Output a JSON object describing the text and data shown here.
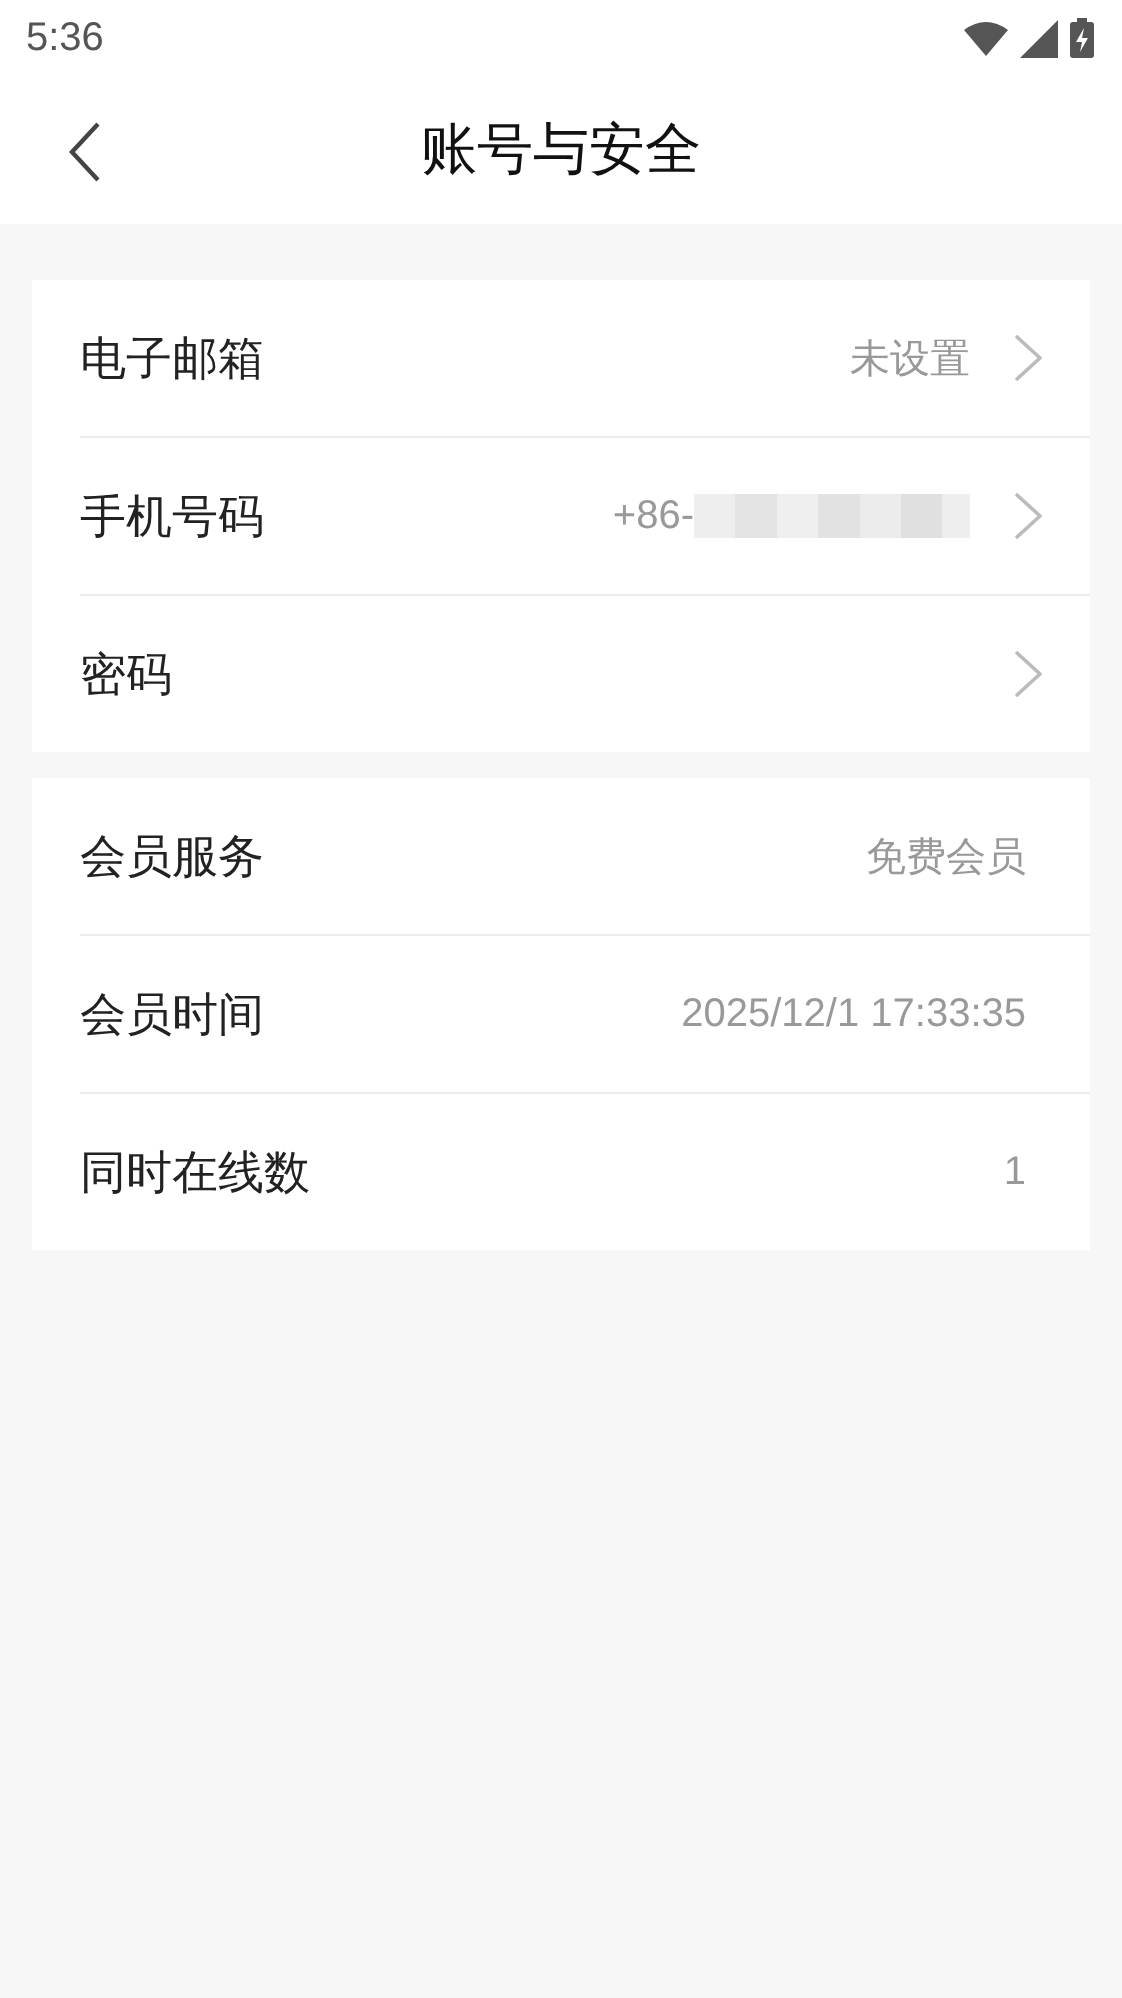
{
  "status_bar": {
    "time": "5:36"
  },
  "header": {
    "title": "账号与安全"
  },
  "groups": [
    {
      "rows": [
        {
          "label": "电子邮箱",
          "value": "未设置",
          "arrow": true
        },
        {
          "label": "手机号码",
          "value": "+86-",
          "masked": true,
          "arrow": true
        },
        {
          "label": "密码",
          "arrow": true
        }
      ]
    },
    {
      "rows": [
        {
          "label": "会员服务",
          "value": "免费会员"
        },
        {
          "label": "会员时间",
          "value": "2025/12/1 17:33:35"
        },
        {
          "label": "同时在线数",
          "value": "1"
        }
      ]
    }
  ]
}
